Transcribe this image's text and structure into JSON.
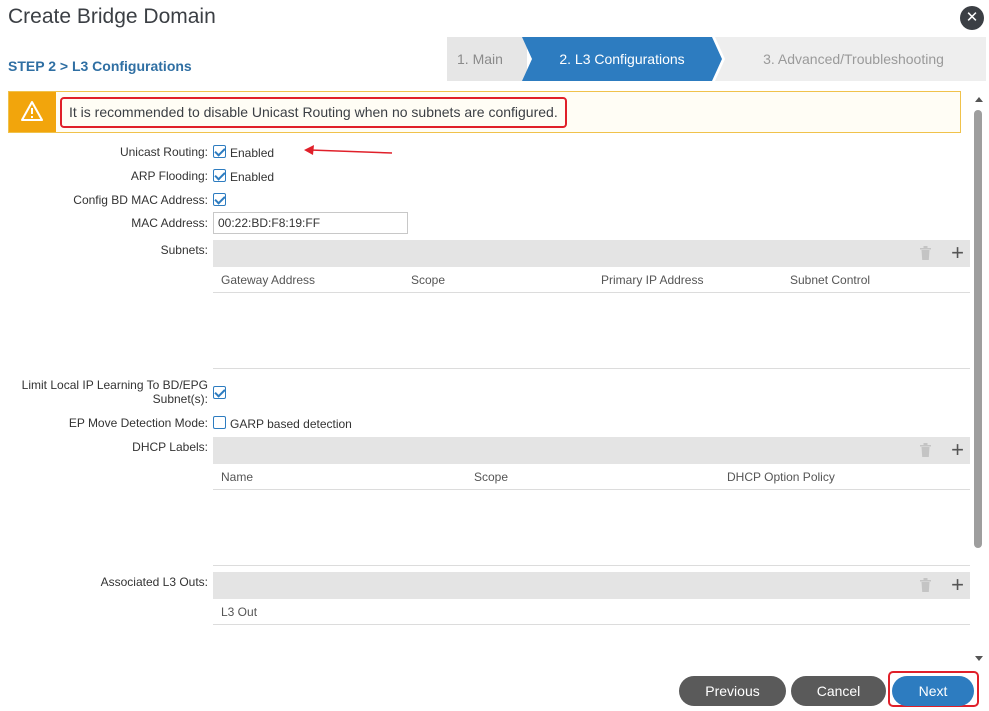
{
  "dialog": {
    "title": "Create Bridge Domain",
    "close_icon": "close-icon"
  },
  "step": {
    "label": "STEP 2 > L3 Configurations"
  },
  "wizard": {
    "steps": [
      "1. Main",
      "2. L3 Configurations",
      "3. Advanced/Troubleshooting"
    ],
    "active_index": 1
  },
  "warning": {
    "icon": "warning-icon",
    "text": "It is recommended to disable Unicast Routing when no subnets are configured."
  },
  "form": {
    "unicast_routing": {
      "label": "Unicast Routing:",
      "checked": true,
      "text": "Enabled"
    },
    "arp_flooding": {
      "label": "ARP Flooding:",
      "checked": true,
      "text": "Enabled"
    },
    "config_bd_mac": {
      "label": "Config BD MAC Address:",
      "checked": true
    },
    "mac_address": {
      "label": "MAC Address:",
      "value": "00:22:BD:F8:19:FF"
    },
    "subnets": {
      "label": "Subnets:",
      "columns": [
        "Gateway Address",
        "Scope",
        "Primary IP Address",
        "Subnet Control"
      ]
    },
    "limit_local_ip": {
      "label_line1": "Limit Local IP Learning To BD/EPG",
      "label_line2": "Subnet(s):",
      "checked": true
    },
    "ep_move": {
      "label": "EP Move Detection Mode:",
      "checked": false,
      "text": "GARP based detection"
    },
    "dhcp_labels": {
      "label": "DHCP Labels:",
      "columns": [
        "Name",
        "Scope",
        "DHCP Option Policy"
      ]
    },
    "l3_outs": {
      "label": "Associated L3 Outs:",
      "columns": [
        "L3 Out"
      ]
    }
  },
  "buttons": {
    "previous": "Previous",
    "cancel": "Cancel",
    "next": "Next"
  },
  "colors": {
    "accent": "#2d7cc0",
    "warning": "#f2a50c",
    "highlight": "#e0202a"
  }
}
